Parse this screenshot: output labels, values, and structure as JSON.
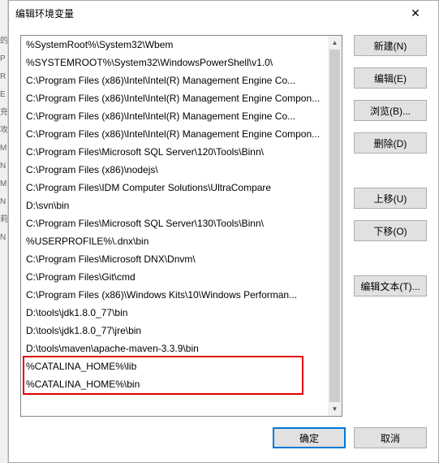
{
  "left_edge_chars": [
    "的",
    " ",
    "P",
    "R",
    "E",
    " ",
    " ",
    "充",
    "攻",
    "M",
    "N",
    "M",
    "N",
    "莉",
    "N"
  ],
  "dialog": {
    "title": "编辑环境变量",
    "close_symbol": "✕"
  },
  "list": {
    "items": [
      "%SystemRoot%\\System32\\Wbem",
      "%SYSTEMROOT%\\System32\\WindowsPowerShell\\v1.0\\",
      "C:\\Program Files (x86)\\Intel\\Intel(R) Management Engine Co...",
      "C:\\Program Files (x86)\\Intel\\Intel(R) Management Engine Compon...",
      "C:\\Program Files (x86)\\Intel\\Intel(R) Management Engine Co...",
      "C:\\Program Files (x86)\\Intel\\Intel(R) Management Engine Compon...",
      "C:\\Program Files\\Microsoft SQL Server\\120\\Tools\\Binn\\",
      "C:\\Program Files (x86)\\nodejs\\",
      "C:\\Program Files\\IDM Computer Solutions\\UltraCompare",
      "D:\\svn\\bin",
      "C:\\Program Files\\Microsoft SQL Server\\130\\Tools\\Binn\\",
      "%USERPROFILE%\\.dnx\\bin",
      "C:\\Program Files\\Microsoft DNX\\Dnvm\\",
      "C:\\Program Files\\Git\\cmd",
      "C:\\Program Files (x86)\\Windows Kits\\10\\Windows Performan...",
      "D:\\tools\\jdk1.8.0_77\\bin",
      "D:\\tools\\jdk1.8.0_77\\jre\\bin",
      "D:\\tools\\maven\\apache-maven-3.3.9\\bin",
      "%CATALINA_HOME%\\lib",
      "%CATALINA_HOME%\\bin"
    ],
    "highlighted_indices": [
      18,
      19
    ]
  },
  "buttons": {
    "new": "新建(N)",
    "edit": "编辑(E)",
    "browse": "浏览(B)...",
    "delete": "删除(D)",
    "move_up": "上移(U)",
    "move_down": "下移(O)",
    "edit_text": "编辑文本(T)...",
    "ok": "确定",
    "cancel": "取消"
  },
  "scrollbar": {
    "up": "▲",
    "down": "▼"
  }
}
